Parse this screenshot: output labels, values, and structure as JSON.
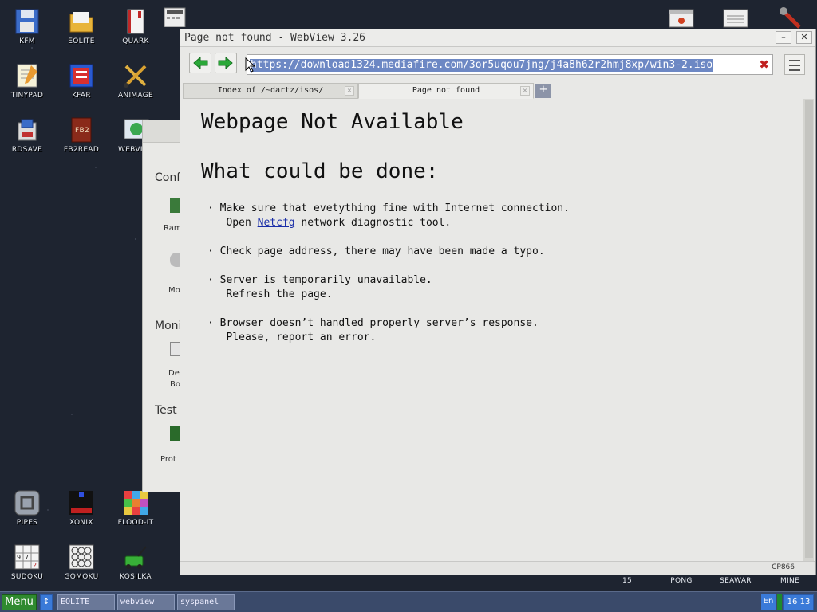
{
  "desktop": {
    "icons_left": [
      {
        "label": "KFM"
      },
      {
        "label": "EOLITE"
      },
      {
        "label": "QUARK"
      },
      {
        "label": "TINYPAD"
      },
      {
        "label": "KFAR"
      },
      {
        "label": "ANIMAGE"
      },
      {
        "label": "RDSAVE"
      },
      {
        "label": "FB2READ"
      },
      {
        "label": "WEBVI"
      },
      {
        "label": "PIPES"
      },
      {
        "label": "XONIX"
      },
      {
        "label": "FLOOD-IT"
      },
      {
        "label": "SUDOKU"
      },
      {
        "label": "GOMOKU"
      },
      {
        "label": "KOSILKA"
      }
    ],
    "icons_right": [
      {
        "label": "15"
      },
      {
        "label": "PONG"
      },
      {
        "label": "SEAWAR"
      },
      {
        "label": "MINE"
      }
    ]
  },
  "bg_window": {
    "section1": "Conf",
    "item1": "Ram",
    "item2": "Mo",
    "section2": "Moni",
    "item3a": "De",
    "item3b": "Bo",
    "section3": "Test",
    "item4": "Prot"
  },
  "webview": {
    "title": "Page not found - WebView 3.26",
    "url": "https://download1324.mediafire.com/3or5uqou7jng/j4a8h62r2hmj8xp/win3-2.iso",
    "tabs": [
      {
        "label": "Index of /~dartz/isos/"
      },
      {
        "label": "Page not found"
      }
    ],
    "content": {
      "heading1": "Webpage Not Available",
      "heading2": "What could be done:",
      "item1_line1": "· Make sure that evetything fine with Internet connection.",
      "item1_line2_prefix": "   Open ",
      "item1_link": "Netcfg",
      "item1_line2_suffix": " network diagnostic tool.",
      "item2": "· Check page address, there may have been made a typo.",
      "item3_line1": "· Server is temporarily unavailable.",
      "item3_line2": "   Refresh the page.",
      "item4_line1": "· Browser doesn’t handled properly server’s response.",
      "item4_line2": "   Please, report an error."
    },
    "status_encoding": "CP866"
  },
  "taskbar": {
    "menu_label": "Menu",
    "tasks": [
      {
        "label": "EOLITE"
      },
      {
        "label": "webview"
      },
      {
        "label": "syspanel"
      }
    ],
    "lang": "En",
    "clock": "16 13"
  }
}
